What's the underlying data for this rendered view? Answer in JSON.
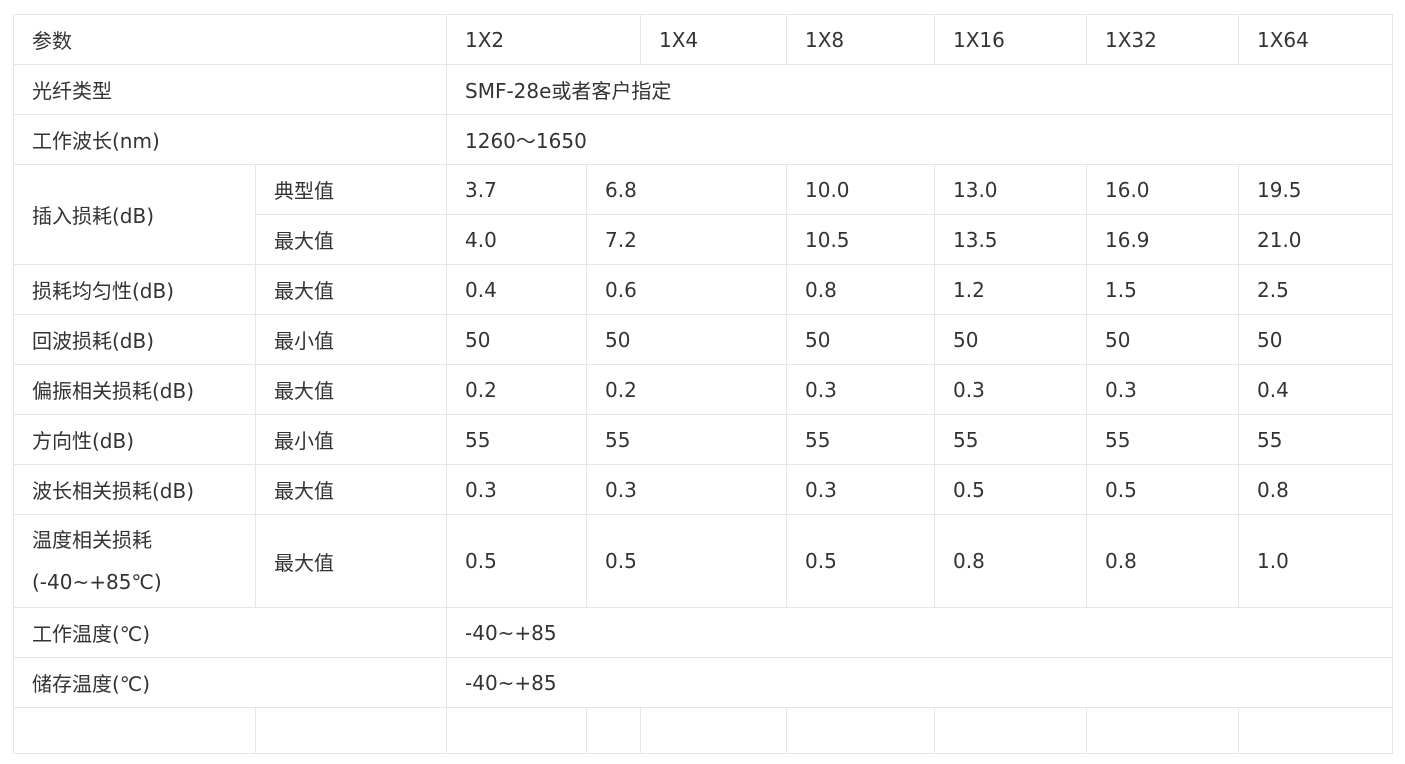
{
  "table": {
    "header": [
      "参数",
      "1X2",
      "1X4",
      "1X8",
      "1X16",
      "1X32",
      "1X64"
    ],
    "fiber_type": {
      "label": "光纤类型",
      "value": "SMF-28e或者客户指定"
    },
    "wavelength": {
      "label": "工作波长(nm)",
      "value": "1260～1650"
    },
    "insertion_loss": {
      "label": "插入损耗(dB)",
      "typical": {
        "label": "典型值",
        "values": [
          "3.7",
          "6.8",
          "10.0",
          "13.0",
          "16.0",
          "19.5"
        ]
      },
      "max": {
        "label": "最大值",
        "values": [
          "4.0",
          "7.2",
          "10.5",
          "13.5",
          "16.9",
          "21.0"
        ]
      }
    },
    "rows": [
      {
        "label": "损耗均匀性(dB)",
        "sub": "最大值",
        "values": [
          "0.4",
          "0.6",
          "0.8",
          "1.2",
          "1.5",
          "2.5"
        ]
      },
      {
        "label": "回波损耗(dB)",
        "sub": "最小值",
        "values": [
          "50",
          "50",
          "50",
          "50",
          "50",
          "50"
        ]
      },
      {
        "label": "偏振相关损耗(dB)",
        "sub": "最大值",
        "values": [
          "0.2",
          "0.2",
          "0.3",
          "0.3",
          "0.3",
          "0.4"
        ]
      },
      {
        "label": "方向性(dB)",
        "sub": "最小值",
        "values": [
          "55",
          "55",
          "55",
          "55",
          "55",
          "55"
        ]
      },
      {
        "label": "波长相关损耗(dB)",
        "sub": "最大值",
        "values": [
          "0.3",
          "0.3",
          "0.3",
          "0.5",
          "0.5",
          "0.8"
        ]
      },
      {
        "label": "温度相关损耗(-40~+85℃)",
        "sub": "最大值",
        "values": [
          "0.5",
          "0.5",
          "0.5",
          "0.8",
          "0.8",
          "1.0"
        ]
      }
    ],
    "operating_temp": {
      "label": "工作温度(℃)",
      "value": "-40~+85"
    },
    "storage_temp": {
      "label": "储存温度(℃)",
      "value": "-40~+85"
    }
  }
}
